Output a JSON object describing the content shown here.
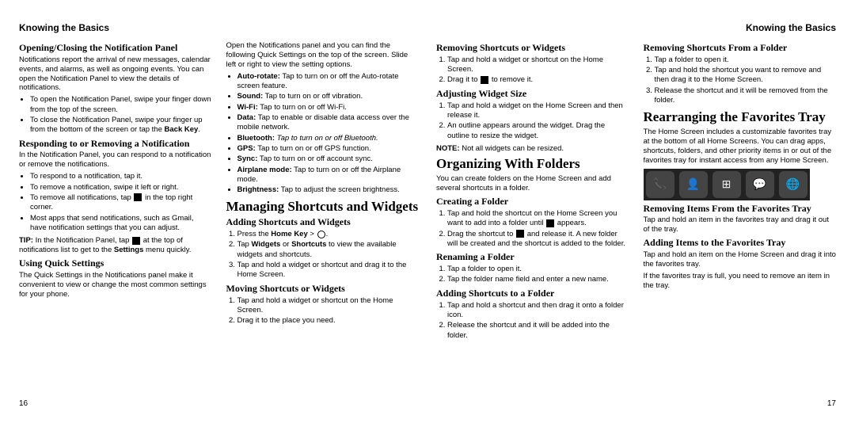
{
  "header_left": "Knowing the Basics",
  "header_right": "Knowing the Basics",
  "page_left_num": "16",
  "page_right_num": "17",
  "left": {
    "c1": {
      "h2_a": "Opening/Closing the Notification Panel",
      "p_a": "Notifications report the arrival of new messages, calendar events, and alarms, as well as ongoing events. You can open the Notification Panel to view the details of notifications.",
      "ul_a1": "To open the Notification Panel, swipe your finger down from the top of the screen.",
      "ul_a2_pre": "To close the Notification Panel, swipe your finger up from the bottom of the screen or tap the ",
      "ul_a2_bold": "Back Key",
      "h2_b": "Responding to or Removing a Notification",
      "p_b": "In the Notification Panel, you can respond to a notification or remove the notifications.",
      "ul_b1": "To respond to a notification, tap it.",
      "ul_b2": "To remove a notification, swipe it left or right.",
      "ul_b3_pre": "To remove all notifications, tap ",
      "ul_b3_post": " in the top right corner.",
      "ul_b4": "Most apps that send notifications, such as Gmail, have notification settings that you can adjust.",
      "tip_bold": "TIP:",
      "tip_pre": " In the Notification Panel, tap ",
      "tip_mid": " at the top of notifications list to get to the ",
      "tip_settings": "Settings",
      "tip_post": " menu quickly.",
      "h2_c": "Using Quick Settings",
      "p_c": "The Quick Settings in the Notifications panel make it convenient to view or change the most common settings for your phone."
    },
    "c2": {
      "p_top": "Open the Notifications panel and you can find the following Quick Settings on the top of the screen. Slide left or right to view the setting options.",
      "li1_b": "Auto-rotate:",
      "li1": " Tap to turn on or off the Auto-rotate screen feature.",
      "li2_b": "Sound:",
      "li2": " Tap to turn on or off vibration.",
      "li3_b": "Wi-Fi:",
      "li3": " Tap to turn on or off Wi-Fi.",
      "li4_b": "Data:",
      "li4": " Tap to enable or disable data access over the mobile network.",
      "li5_b": "Bluetooth:",
      "li5": " Tap to turn on or off Bluetooth.",
      "li6_b": "GPS:",
      "li6": " Tap to turn on or off GPS function.",
      "li7_b": "Sync:",
      "li7": " Tap to turn on or off account sync.",
      "li8_b": "Airplane mode:",
      "li8": " Tap to turn on or off the Airplane mode.",
      "li9_b": "Brightness:",
      "li9": " Tap to adjust the screen brightness.",
      "h1_a": "Managing Shortcuts and Widgets",
      "h2_a": "Adding Shortcuts and Widgets",
      "ol_a1_pre": "Press the ",
      "ol_a1_bold": "Home Key",
      "ol_a1_post": " > ",
      "ol_a2_pre": "Tap ",
      "ol_a2_b1": "Widgets",
      "ol_a2_mid": " or ",
      "ol_a2_b2": "Shortcuts",
      "ol_a2_post": " to view the available widgets and shortcuts.",
      "ol_a3": "Tap and hold a widget or shortcut and drag it to the Home Screen.",
      "h2_b": "Moving Shortcuts or Widgets",
      "ol_b1": "Tap and hold a widget or shortcut on the Home Screen.",
      "ol_b2": "Drag it to the place you need."
    }
  },
  "right": {
    "c1": {
      "h2_a": "Removing Shortcuts or Widgets",
      "ol_a1": "Tap and hold a widget or shortcut on the Home Screen.",
      "ol_a2_pre": "Drag it to ",
      "ol_a2_post": " to remove it.",
      "h2_b": "Adjusting Widget Size",
      "ol_b1": "Tap and hold a widget on the Home Screen and then release it.",
      "ol_b2": "An outline appears around the widget. Drag the outline to resize the widget.",
      "note_b": "NOTE:",
      "note": "Not all widgets can be resized.",
      "h1_a": "Organizing With Folders",
      "p_a": "You can create folders on the Home Screen and add several shortcuts in a folder.",
      "h2_c": "Creating a Folder",
      "ol_c1": "Tap and hold the shortcut on the Home Screen you want to add into a folder until ",
      "ol_c1_post": " appears.",
      "ol_c2_pre": "Drag the shortcut to ",
      "ol_c2_post": " and release it. A new folder will be created and the shortcut is added to the folder.",
      "h2_d": "Renaming a Folder",
      "ol_d1": "Tap a folder to open it.",
      "ol_d2": "Tap the folder name field and enter a new name.",
      "h2_e": "Adding Shortcuts to a Folder",
      "ol_e1": "Tap and hold a shortcut and then drag it onto a folder icon.",
      "ol_e2": "Release the shortcut and it will be added into the folder."
    },
    "c2": {
      "h2_a": "Removing Shortcuts From a Folder",
      "ol_a1": "Tap a folder to open it.",
      "ol_a2": "Tap and hold the shortcut you want to remove and then drag it to the Home Screen.",
      "ol_a3": "Release the shortcut and it will be removed from the folder.",
      "h1_a": "Rearranging the Favorites Tray",
      "p_a": "The Home Screen includes a customizable favorites tray at the bottom of all Home Screens. You can drag apps, shortcuts, folders, and other priority items in or out of the favorites tray for instant access from any Home Screen.",
      "h2_b": "Removing Items From the Favorites Tray",
      "p_b": "Tap and hold an item in the favorites tray and drag it out of the tray.",
      "h2_c": "Adding Items to the Favorites Tray",
      "p_c": "Tap and hold an item on the Home Screen and drag it into the favorites tray.",
      "p_d": "If the favorites tray is full, you need to remove an item in the tray."
    }
  }
}
